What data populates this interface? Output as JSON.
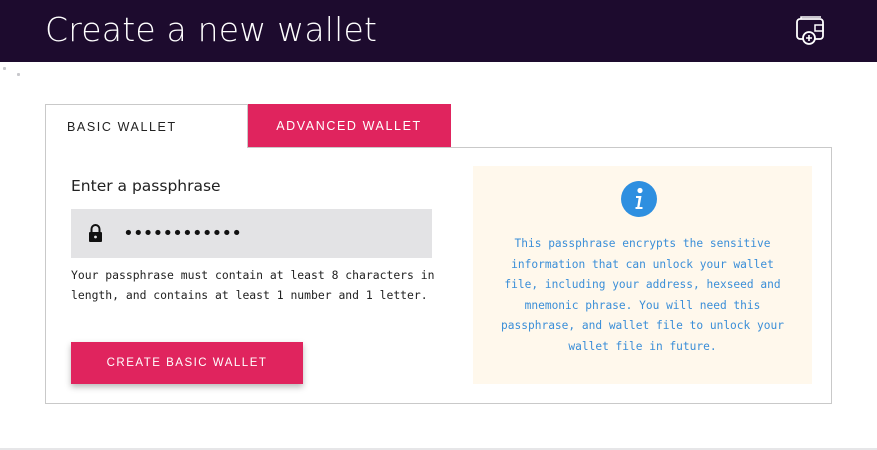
{
  "header": {
    "title": "Create a new wallet",
    "icon": "wallet-add-icon"
  },
  "tabs": [
    {
      "label": "BASIC WALLET",
      "active": true
    },
    {
      "label": "ADVANCED WALLET",
      "active": false
    }
  ],
  "form": {
    "label": "Enter a passphrase",
    "passphrase_value": "............",
    "lock_icon": "lock-icon",
    "helper": "Your passphrase must contain at least 8 characters in length, and contains at least 1 number and 1 letter.",
    "submit_label": "CREATE BASIC WALLET"
  },
  "info": {
    "icon": "info-icon",
    "text": "This passphrase encrypts the sensitive information that can unlock your wallet file, including your address, hexseed and mnemonic phrase. You will need this passphrase, and wallet file to unlock your wallet file in future."
  },
  "colors": {
    "header_bg": "#1d0b2e",
    "accent": "#e0245e",
    "info_bg": "#fff8ec",
    "info_text": "#3a8ed8",
    "info_icon": "#2e8fe0"
  }
}
